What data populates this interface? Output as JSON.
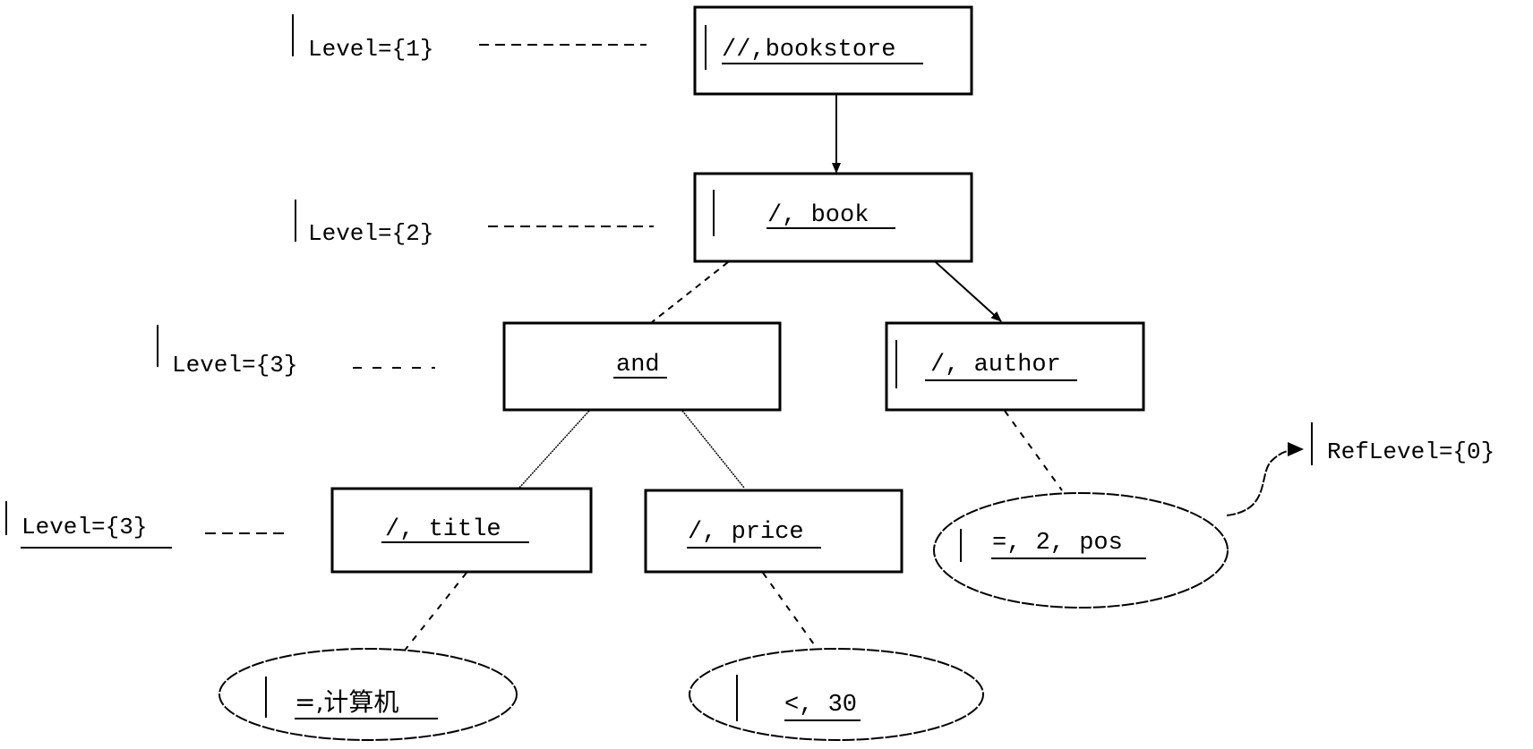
{
  "diagram": {
    "nodes": [
      {
        "id": "bookstore",
        "shape": "rect",
        "text": "//,bookstore",
        "cursor_bar": true
      },
      {
        "id": "book",
        "shape": "rect",
        "text": "/, book",
        "cursor_bar": true
      },
      {
        "id": "and",
        "shape": "rect",
        "text": "and",
        "cursor_bar": false
      },
      {
        "id": "author",
        "shape": "rect",
        "text": "/, author",
        "cursor_bar": true
      },
      {
        "id": "title",
        "shape": "rect",
        "text": "/, title",
        "cursor_bar": false
      },
      {
        "id": "price",
        "shape": "rect",
        "text": "/, price",
        "cursor_bar": false
      },
      {
        "id": "pos",
        "shape": "ellipse",
        "text": "=, 2, pos",
        "cursor_bar": true
      },
      {
        "id": "computer",
        "shape": "ellipse",
        "text": "=,计算机",
        "cursor_bar": true
      },
      {
        "id": "lt30",
        "shape": "ellipse",
        "text": "<, 30",
        "cursor_bar": true
      }
    ],
    "edges": [
      {
        "from": "bookstore",
        "to": "book",
        "style": "solid",
        "arrow": true
      },
      {
        "from": "book",
        "to": "and",
        "style": "dashed",
        "arrow": false
      },
      {
        "from": "book",
        "to": "author",
        "style": "solid",
        "arrow": true
      },
      {
        "from": "and",
        "to": "title",
        "style": "dotted",
        "arrow": false
      },
      {
        "from": "and",
        "to": "price",
        "style": "dotted",
        "arrow": false
      },
      {
        "from": "author",
        "to": "pos",
        "style": "dashed",
        "arrow": false
      },
      {
        "from": "title",
        "to": "computer",
        "style": "dashed",
        "arrow": false
      },
      {
        "from": "price",
        "to": "lt30",
        "style": "dashed",
        "arrow": false
      },
      {
        "from": "pos",
        "to": "reflevel",
        "style": "curved",
        "arrow": true
      }
    ],
    "level_labels": [
      {
        "id": "level-1",
        "text": "Level={1}",
        "underlined": false
      },
      {
        "id": "level-2",
        "text": "Level={2}",
        "underlined": false
      },
      {
        "id": "level-3a",
        "text": "Level={3}",
        "underlined": false
      },
      {
        "id": "level-3b",
        "text": "Level={3}",
        "underlined": true
      }
    ],
    "ref_label": {
      "text": "RefLevel={0}"
    }
  }
}
